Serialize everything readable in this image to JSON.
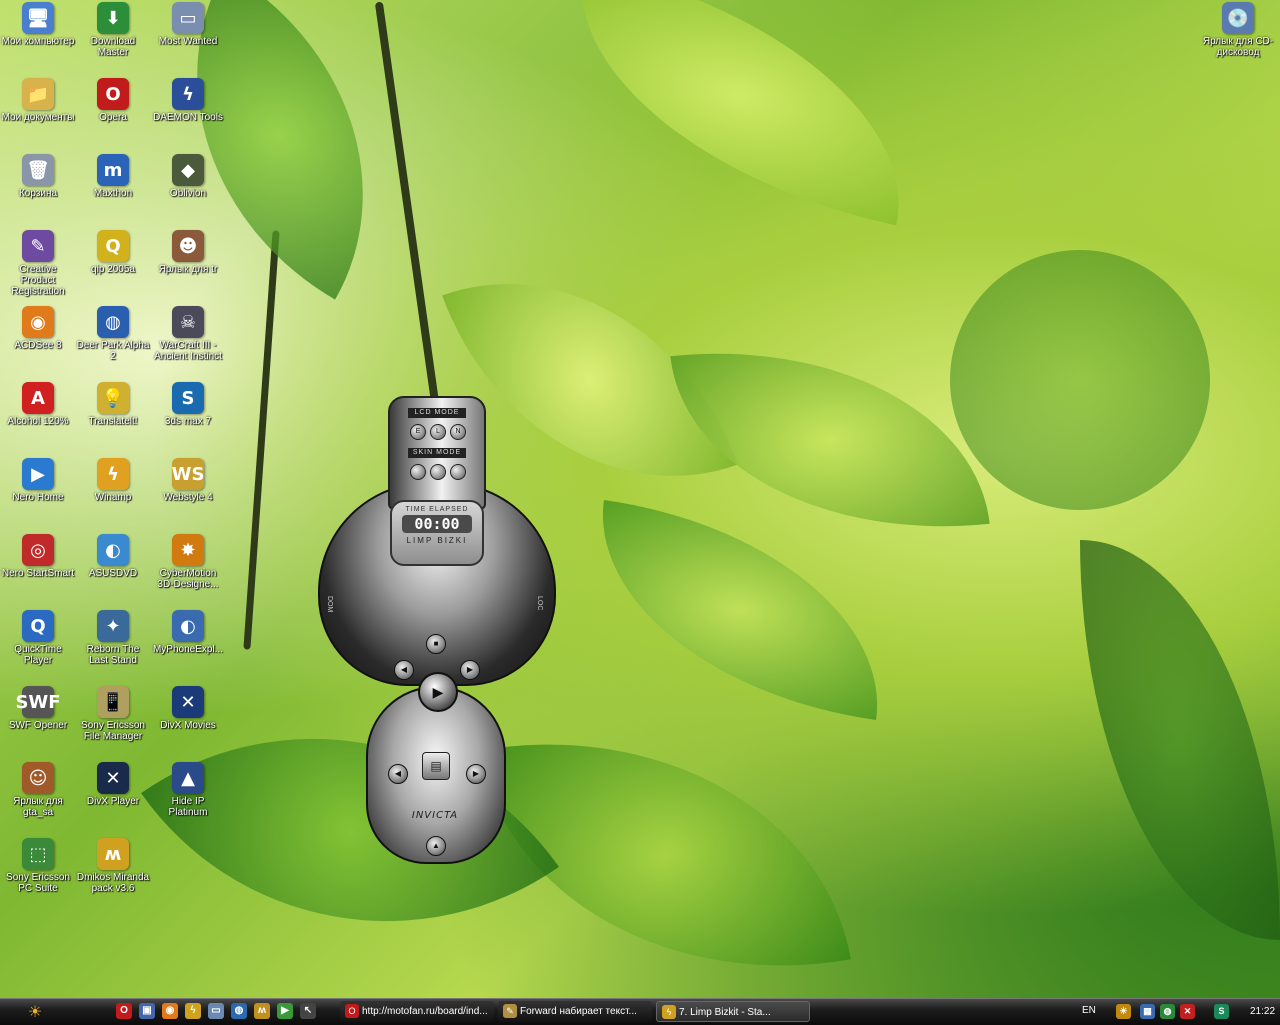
{
  "desktop": {
    "icons": [
      {
        "label": "Мои компьютер",
        "glyph": "🖥",
        "color": "#4a7fd0"
      },
      {
        "label": "Download Master",
        "glyph": "⬇",
        "color": "#2d8e3a"
      },
      {
        "label": "Most Wanted",
        "glyph": "▭",
        "color": "#7a8fb0"
      },
      {
        "label": "Мои документы",
        "glyph": "📁",
        "color": "#d8b24a"
      },
      {
        "label": "Opera",
        "glyph": "O",
        "color": "#c21b1b"
      },
      {
        "label": "DAEMON Tools",
        "glyph": "ϟ",
        "color": "#2a4e9a"
      },
      {
        "label": "Корзина",
        "glyph": "🗑",
        "color": "#8a96a8"
      },
      {
        "label": "Maxthon",
        "glyph": "m",
        "color": "#2b63b8"
      },
      {
        "label": "Oblivion",
        "glyph": "◆",
        "color": "#4a5a3a"
      },
      {
        "label": "Creative Product Registration",
        "glyph": "✎",
        "color": "#6e4aa0"
      },
      {
        "label": "qip 2005a",
        "glyph": "Q",
        "color": "#d2b21c"
      },
      {
        "label": "Ярлык для tr",
        "glyph": "☻",
        "color": "#8a5a3a"
      },
      {
        "label": "ACDSee 8",
        "glyph": "◉",
        "color": "#e07a1a"
      },
      {
        "label": "Deer Park Alpha 2",
        "glyph": "◍",
        "color": "#2a5fb0"
      },
      {
        "label": "WarCraft III - Ancient Instinct",
        "glyph": "☠",
        "color": "#4a4a5a"
      },
      {
        "label": "Alcohol 120%",
        "glyph": "A",
        "color": "#d02020"
      },
      {
        "label": "Translatelt!",
        "glyph": "💡",
        "color": "#d0b030"
      },
      {
        "label": "3ds max 7",
        "glyph": "S",
        "color": "#1a6ab0"
      },
      {
        "label": "Nero Home",
        "glyph": "▶",
        "color": "#2a7ad0"
      },
      {
        "label": "Winamp",
        "glyph": "ϟ",
        "color": "#e0a020"
      },
      {
        "label": "Webstyle 4",
        "glyph": "WS",
        "color": "#c9a030"
      },
      {
        "label": "Nero StartSmart",
        "glyph": "◎",
        "color": "#c02a2a"
      },
      {
        "label": "ASUSDVD",
        "glyph": "◐",
        "color": "#3a8ad0"
      },
      {
        "label": "CyberMotion 3D-Designe...",
        "glyph": "✸",
        "color": "#d07a10"
      },
      {
        "label": "QuickTime Player",
        "glyph": "Q",
        "color": "#2a6ac0"
      },
      {
        "label": "Reborn The Last Stand",
        "glyph": "✦",
        "color": "#3a6a9a"
      },
      {
        "label": "MyPhoneExpl...",
        "glyph": "◐",
        "color": "#3a6ab0"
      },
      {
        "label": "SWF Opener",
        "glyph": "SWF",
        "color": "#555555"
      },
      {
        "label": "Sony Ericsson File Manager",
        "glyph": "📱",
        "color": "#b0a060"
      },
      {
        "label": "DivX Movies",
        "glyph": "✕",
        "color": "#1a3a7a"
      },
      {
        "label": "Ярлык для gta_sa",
        "glyph": "☺",
        "color": "#a05a2a"
      },
      {
        "label": "DivX Player",
        "glyph": "✕",
        "color": "#1a2a4a"
      },
      {
        "label": "Hide IP Platinum",
        "glyph": "▲",
        "color": "#2a4a8a"
      },
      {
        "label": "Sony Ericsson PC Suite",
        "glyph": "⬚",
        "color": "#3a8a3a"
      },
      {
        "label": "Dmikos Miranda pack v3.6",
        "glyph": "ʍ",
        "color": "#d0a020"
      },
      {
        "label": "Ярлык для CD-дисковод",
        "glyph": "💿",
        "color": "#5a7ab0"
      }
    ]
  },
  "player": {
    "lcd_mode": "LCD MODE",
    "skin_mode": "SKIN MODE",
    "time_label": "TIME ELAPSED",
    "time": "00:00",
    "track": "LIMP BIZKI",
    "brand": "INVICTA",
    "left_label": "DOM",
    "right_label": "LOC",
    "lcd_buttons": [
      "E",
      "L",
      "N"
    ],
    "play_symbol": "▶",
    "menu_symbol": "▤"
  },
  "taskbar": {
    "start_symbol": "☀",
    "quicklaunch": [
      {
        "name": "opera-quick-icon",
        "glyph": "O",
        "color": "#c21b1b"
      },
      {
        "name": "floppy-quick-icon",
        "glyph": "▣",
        "color": "#4466aa"
      },
      {
        "name": "acdsee-quick-icon",
        "glyph": "◉",
        "color": "#e07a1a"
      },
      {
        "name": "translate-quick-icon",
        "glyph": "ϟ",
        "color": "#d0a020"
      },
      {
        "name": "window-quick-icon",
        "glyph": "▭",
        "color": "#6a8ab0"
      },
      {
        "name": "globe-quick-icon",
        "glyph": "◍",
        "color": "#2a6ab0"
      },
      {
        "name": "miranda-quick-icon",
        "glyph": "ʍ",
        "color": "#c09020"
      },
      {
        "name": "play-quick-icon",
        "glyph": "▶",
        "color": "#3a9a3a"
      },
      {
        "name": "cursor-quick-icon",
        "glyph": "↖",
        "color": "#444444"
      }
    ],
    "tasks": [
      {
        "label": "http://motofan.ru/board/ind...",
        "glyph": "O",
        "color": "#c21b1b",
        "active": false
      },
      {
        "label": "Forward набирает текст...",
        "glyph": "✎",
        "color": "#b09040",
        "active": false
      },
      {
        "label": "7. Limp Bizkit            - Sta...",
        "glyph": "ϟ",
        "color": "#d0a020",
        "active": true
      }
    ],
    "lang": "EN",
    "tray_icons": [
      {
        "name": "sun-tray-icon",
        "glyph": "☀",
        "color": "#c08a10"
      },
      {
        "name": "network-tray-icon",
        "glyph": "▦",
        "color": "#3a6ab0"
      },
      {
        "name": "globe-tray-icon",
        "glyph": "◍",
        "color": "#2a8a3a"
      },
      {
        "name": "antivirus-tray-icon",
        "glyph": "✕",
        "color": "#c02020"
      },
      {
        "name": "chat-tray-icon",
        "glyph": "S",
        "color": "#1a8a5a"
      }
    ],
    "clock": "21:22"
  }
}
